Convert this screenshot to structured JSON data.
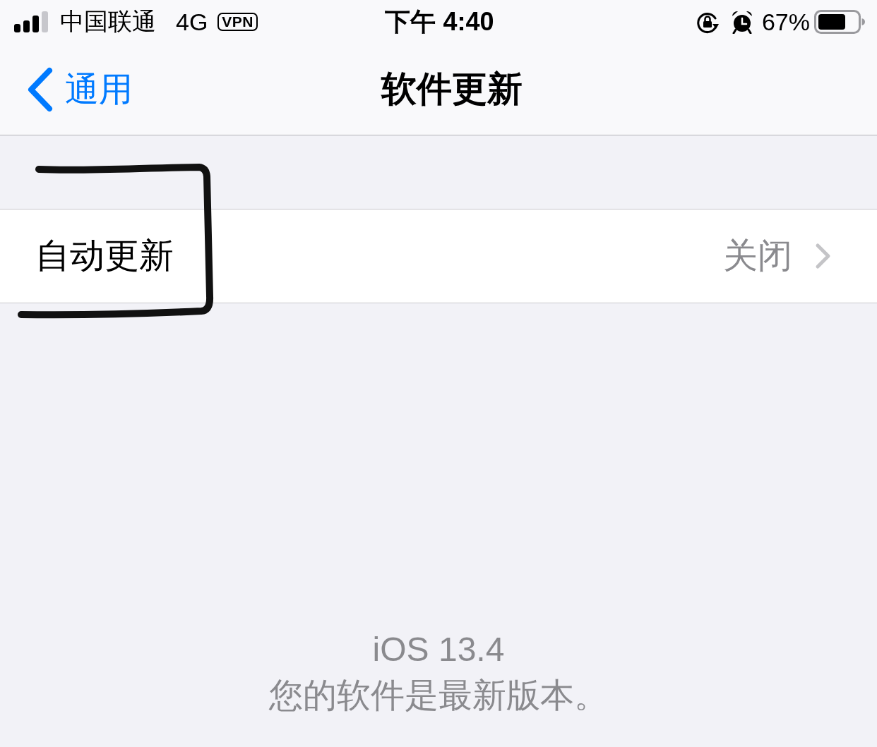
{
  "status_bar": {
    "carrier": "中国联通",
    "network": "4G",
    "vpn": "VPN",
    "time": "下午 4:40",
    "battery_percent": "67%"
  },
  "nav_bar": {
    "back": "通用",
    "title": "软件更新"
  },
  "rows": [
    {
      "label": "自动更新",
      "value": "关闭"
    }
  ],
  "footer": {
    "version": "iOS 13.4",
    "message": "您的软件是最新版本。"
  }
}
